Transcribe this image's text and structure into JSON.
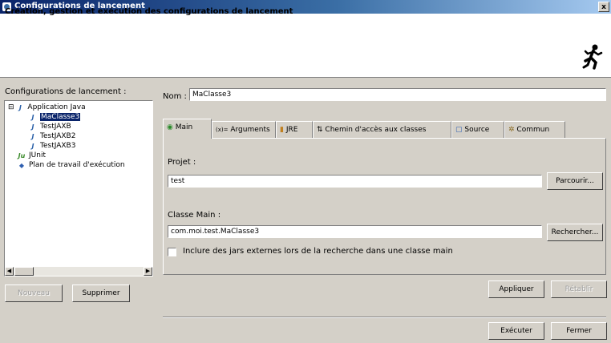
{
  "window": {
    "title": "Configurations de lancement",
    "close_glyph": "x"
  },
  "header": {
    "text": "Création, gestion et exécution des configurations de lancement",
    "icon": "running-man-icon"
  },
  "sidebar": {
    "label": "Configurations de lancement :",
    "tree": [
      {
        "label": "Application Java",
        "expander": "⊟",
        "icon": "java-app-icon"
      },
      {
        "label": "MaClasse3",
        "selected": true,
        "icon": "java-class-icon"
      },
      {
        "label": "TestJAXB",
        "icon": "java-class-icon"
      },
      {
        "label": "TestJAXB2",
        "icon": "java-class-icon"
      },
      {
        "label": "TestJAXB3",
        "icon": "java-class-icon"
      },
      {
        "label": "JUnit",
        "icon": "junit-icon"
      },
      {
        "label": "Plan de travail d'exécution",
        "icon": "workbench-icon"
      }
    ],
    "buttons": {
      "new": "Nouveau",
      "delete": "Supprimer"
    }
  },
  "form": {
    "name_label": "Nom :",
    "name_value": "MaClasse3",
    "tabs": [
      {
        "label": "Main",
        "icon": "main-tab-icon",
        "glyph": "◉"
      },
      {
        "label": "Arguments",
        "icon": "arguments-tab-icon",
        "glyph": "(x)="
      },
      {
        "label": "JRE",
        "icon": "jre-tab-icon",
        "glyph": "▮"
      },
      {
        "label": "Chemin d'accès aux classes",
        "icon": "classpath-tab-icon",
        "glyph": "⇅"
      },
      {
        "label": "Source",
        "icon": "source-tab-icon",
        "glyph": "▢"
      },
      {
        "label": "Commun",
        "icon": "common-tab-icon",
        "glyph": "✲"
      }
    ],
    "project_label": "Projet :",
    "project_value": "test",
    "browse_button": "Parcourir...",
    "main_class_label": "Classe Main :",
    "main_class_value": "com.moi.test.MaClasse3",
    "search_button": "Rechercher...",
    "include_checkbox_label": "Inclure des jars externes lors de la recherche dans une classe main",
    "apply_button": "Appliquer",
    "restore_button": "Rétablir"
  },
  "footer": {
    "run_button": "Exécuter",
    "close_button": "Fermer"
  }
}
